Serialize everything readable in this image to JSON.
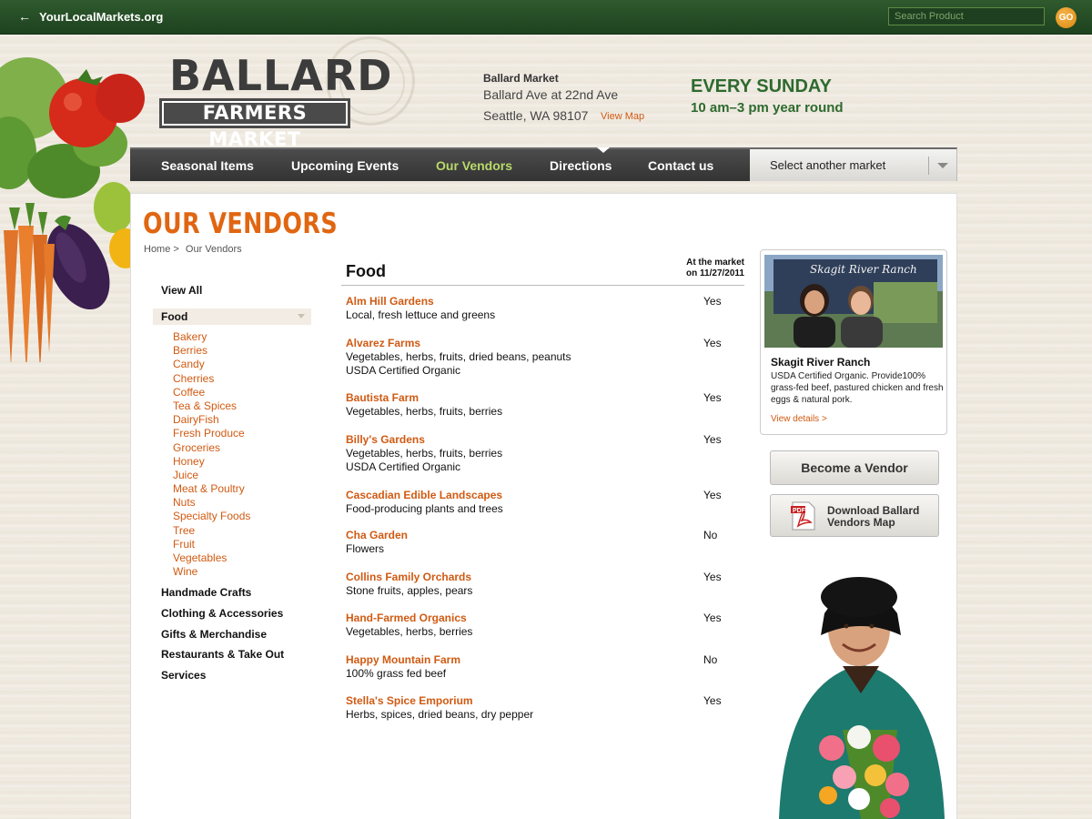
{
  "topbar": {
    "back_icon": "arrow-left-icon",
    "site_name": "YourLocalMarkets.org",
    "search_placeholder": "Search Product",
    "go_label": "GO"
  },
  "logo": {
    "line1": "BALLARD",
    "line2": "FARMERS MARKET"
  },
  "address": {
    "name": "Ballard Market",
    "street": "Ballard Ave at 22nd Ave",
    "city": "Seattle, WA 98107",
    "map_link": "View Map"
  },
  "schedule": {
    "day": "EVERY SUNDAY",
    "hours": "10 am–3 pm year round"
  },
  "nav": {
    "items": [
      "Seasonal Items",
      "Upcoming Events",
      "Our Vendors",
      "Directions",
      "Contact us"
    ],
    "active": "Our Vendors",
    "market_select": "Select another market"
  },
  "page": {
    "title": "OUR VENDORS",
    "breadcrumb": [
      "Home >",
      "Our Vendors"
    ]
  },
  "sidebar": {
    "view_all": "View All",
    "food": "Food",
    "food_subcategories": [
      "Bakery",
      "Berries",
      "Candy",
      "Cherries",
      "Coffee",
      "Tea & Spices",
      "DairyFish",
      "Fresh Produce",
      "Groceries",
      "Honey",
      "Juice",
      "Meat & Poultry",
      "Nuts",
      "Specialty Foods",
      "Tree",
      "Fruit",
      "Vegetables",
      "Wine"
    ],
    "other_categories": [
      "Handmade Crafts",
      "Clothing & Accessories",
      "Gifts & Merchandise",
      "Restaurants & Take Out",
      "Services"
    ]
  },
  "vendors": {
    "category_title": "Food",
    "column_header_line1": "At the market",
    "column_header_line2": "on 11/27/2011",
    "rows": [
      {
        "name": "Alm Hill Gardens",
        "desc": [
          "Local, fresh lettuce and greens"
        ],
        "present": "Yes"
      },
      {
        "name": "Alvarez Farms",
        "desc": [
          "Vegetables, herbs, fruits, dried beans, peanuts",
          "USDA Certified Organic"
        ],
        "present": "Yes"
      },
      {
        "name": "Bautista Farm",
        "desc": [
          "Vegetables, herbs, fruits, berries"
        ],
        "present": "Yes"
      },
      {
        "name": "Billy's Gardens",
        "desc": [
          "Vegetables, herbs, fruits, berries",
          "USDA Certified Organic"
        ],
        "present": "Yes"
      },
      {
        "name": "Cascadian Edible Landscapes",
        "desc": [
          "Food-producing plants and trees"
        ],
        "present": "Yes"
      },
      {
        "name": "Cha Garden",
        "desc": [
          "Flowers"
        ],
        "present": "No"
      },
      {
        "name": "Collins Family Orchards",
        "desc": [
          "Stone fruits, apples, pears"
        ],
        "present": "Yes"
      },
      {
        "name": "Hand-Farmed Organics",
        "desc": [
          "Vegetables, herbs, berries"
        ],
        "present": "Yes"
      },
      {
        "name": "Happy Mountain Farm",
        "desc": [
          "100% grass fed beef"
        ],
        "present": "No"
      },
      {
        "name": "Stella's Spice Emporium",
        "desc": [
          "Herbs, spices, dried beans, dry pepper"
        ],
        "present": "Yes"
      }
    ]
  },
  "feature": {
    "photo_sign": "Skagit River Ranch",
    "title": "Skagit River Ranch",
    "desc": "USDA Certified Organic. Provide100% grass-fed beef, pastured chicken and fresh eggs & natural pork.",
    "link": "View details >"
  },
  "buttons": {
    "become_vendor": "Become a Vendor",
    "download_map_line1": "Download Ballard",
    "download_map_line2": "Vendors Map",
    "pdf_icon": "pdf-icon"
  },
  "colors": {
    "topbar": "#244a24",
    "accent_orange": "#d05a12",
    "title_orange": "#e06612",
    "schedule_green": "#2e6a2e",
    "nav_active": "#b9d96a"
  }
}
